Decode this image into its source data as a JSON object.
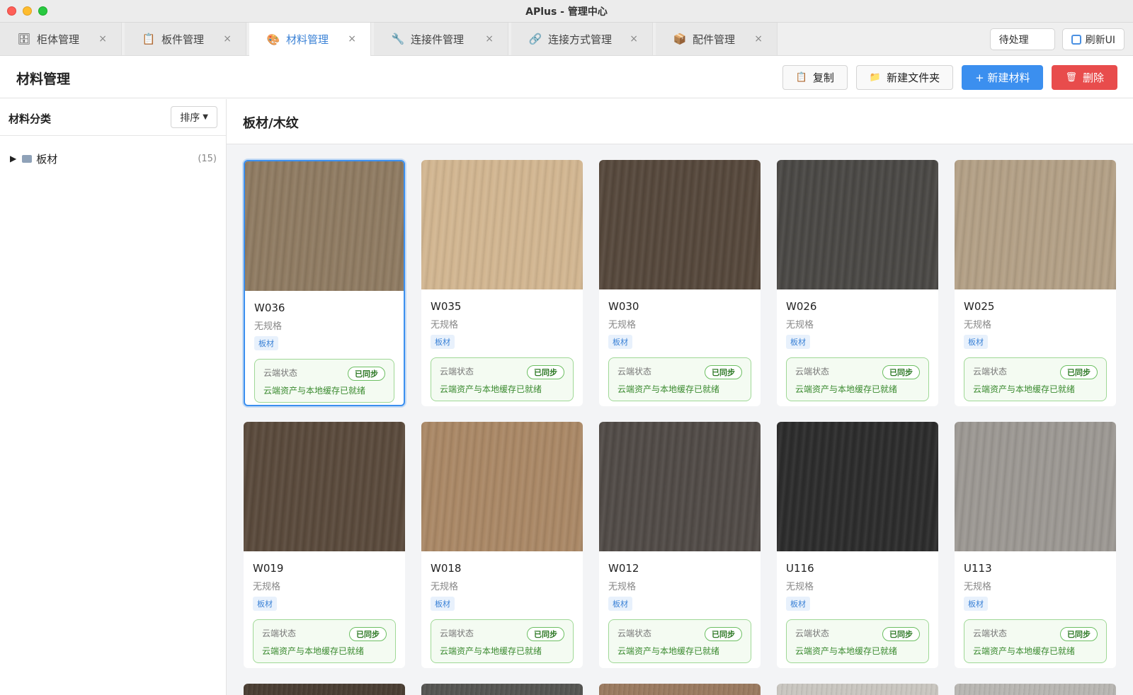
{
  "window": {
    "title": "APlus - 管理中心"
  },
  "tabs": [
    {
      "label": "柜体管理",
      "icon": "cabinet-icon",
      "glyph": "🗄"
    },
    {
      "label": "板件管理",
      "icon": "board-icon",
      "glyph": "📋"
    },
    {
      "label": "材料管理",
      "icon": "material-icon",
      "glyph": "🎨"
    },
    {
      "label": "连接件管理",
      "icon": "wrench-icon",
      "glyph": "🔧"
    },
    {
      "label": "连接方式管理",
      "icon": "link-icon",
      "glyph": "🔗"
    },
    {
      "label": "配件管理",
      "icon": "box-icon",
      "glyph": "📦"
    }
  ],
  "tab_close": "×",
  "top_actions": {
    "pending": "待处理",
    "refresh": "刷新UI"
  },
  "header": {
    "title": "材料管理",
    "copy": "复制",
    "new_folder": "新建文件夹",
    "new_material": "+ 新建材料",
    "delete": "删除"
  },
  "sidebar": {
    "title": "材料分类",
    "sort": "排序",
    "tree": [
      {
        "label": "板材",
        "count": "(15)"
      }
    ]
  },
  "main": {
    "breadcrumb": "板材/木纹"
  },
  "cloud": {
    "label": "云端状态",
    "badge": "已同步",
    "message": "云端资产与本地缓存已就绪"
  },
  "materials": [
    {
      "code": "W036",
      "spec": "无规格",
      "tag": "板材",
      "color": "#8f7b62",
      "selected": true
    },
    {
      "code": "W035",
      "spec": "无规格",
      "tag": "板材",
      "color": "#d2b691"
    },
    {
      "code": "W030",
      "spec": "无规格",
      "tag": "板材",
      "color": "#56483c"
    },
    {
      "code": "W026",
      "spec": "无规格",
      "tag": "板材",
      "color": "#4a4845"
    },
    {
      "code": "W025",
      "spec": "无规格",
      "tag": "板材",
      "color": "#b3a086"
    },
    {
      "code": "W019",
      "spec": "无规格",
      "tag": "板材",
      "color": "#5a4a3c"
    },
    {
      "code": "W018",
      "spec": "无规格",
      "tag": "板材",
      "color": "#aa8866"
    },
    {
      "code": "W012",
      "spec": "无规格",
      "tag": "板材",
      "color": "#514b47"
    },
    {
      "code": "U116",
      "spec": "无规格",
      "tag": "板材",
      "color": "#2c2c2c"
    },
    {
      "code": "U113",
      "spec": "无规格",
      "tag": "板材",
      "color": "#9c9893"
    }
  ],
  "partial_row_colors": [
    "#4a3e33",
    "#555552",
    "#9a7a60",
    "#c9c6c0",
    "#b8b6b2"
  ]
}
